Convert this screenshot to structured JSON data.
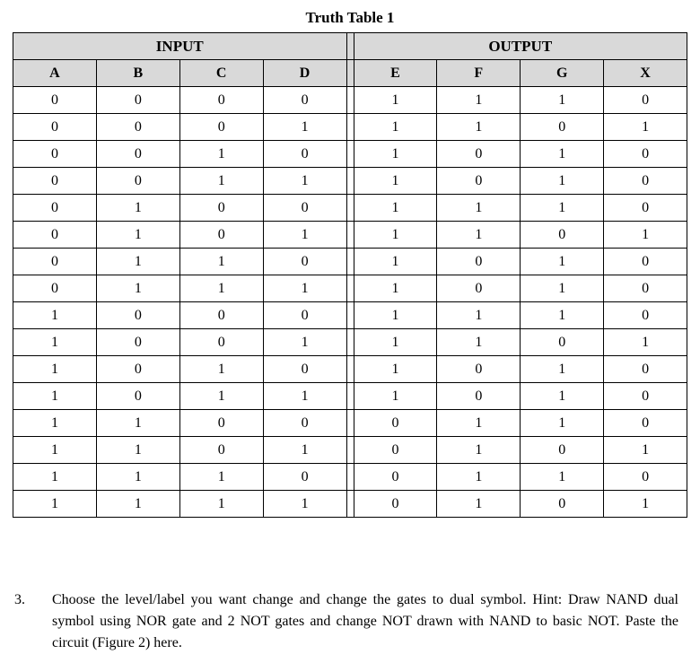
{
  "title": "Truth Table 1",
  "group_headers": {
    "input": "INPUT",
    "output": "OUTPUT"
  },
  "columns": [
    "A",
    "B",
    "C",
    "D",
    "E",
    "F",
    "G",
    "X"
  ],
  "chart_data": {
    "type": "table",
    "columns": [
      "A",
      "B",
      "C",
      "D",
      "E",
      "F",
      "G",
      "X"
    ],
    "rows": [
      [
        0,
        0,
        0,
        0,
        1,
        1,
        1,
        0
      ],
      [
        0,
        0,
        0,
        1,
        1,
        1,
        0,
        1
      ],
      [
        0,
        0,
        1,
        0,
        1,
        0,
        1,
        0
      ],
      [
        0,
        0,
        1,
        1,
        1,
        0,
        1,
        0
      ],
      [
        0,
        1,
        0,
        0,
        1,
        1,
        1,
        0
      ],
      [
        0,
        1,
        0,
        1,
        1,
        1,
        0,
        1
      ],
      [
        0,
        1,
        1,
        0,
        1,
        0,
        1,
        0
      ],
      [
        0,
        1,
        1,
        1,
        1,
        0,
        1,
        0
      ],
      [
        1,
        0,
        0,
        0,
        1,
        1,
        1,
        0
      ],
      [
        1,
        0,
        0,
        1,
        1,
        1,
        0,
        1
      ],
      [
        1,
        0,
        1,
        0,
        1,
        0,
        1,
        0
      ],
      [
        1,
        0,
        1,
        1,
        1,
        0,
        1,
        0
      ],
      [
        1,
        1,
        0,
        0,
        0,
        1,
        1,
        0
      ],
      [
        1,
        1,
        0,
        1,
        0,
        1,
        0,
        1
      ],
      [
        1,
        1,
        1,
        0,
        0,
        1,
        1,
        0
      ],
      [
        1,
        1,
        1,
        1,
        0,
        1,
        0,
        1
      ]
    ]
  },
  "question": {
    "number": "3.",
    "text": "Choose the level/label you want change and change the gates to dual symbol. Hint: Draw NAND dual symbol using NOR gate and 2 NOT gates and change NOT drawn with NAND to basic NOT. Paste the circuit (Figure 2) here."
  }
}
